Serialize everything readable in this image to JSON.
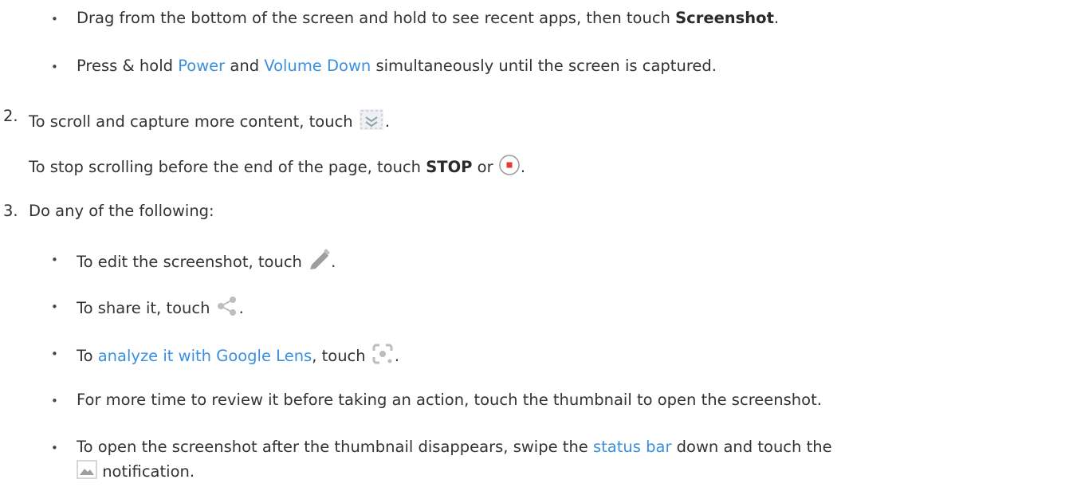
{
  "step1_bullets": {
    "recent": {
      "before": "Drag from the bottom of the screen and hold to see recent apps, then touch ",
      "bold": "Screenshot",
      "after": "."
    },
    "buttons": {
      "before": "Press & hold ",
      "link1": "Power",
      "mid": " and ",
      "link2": "Volume Down",
      "after": " simultaneously until the screen is captured."
    }
  },
  "step2": {
    "number": "2.",
    "text": "To scroll and capture more content, touch ",
    "icon": "scroll-capture-icon",
    "after": ".",
    "stop": {
      "before": "To stop scrolling before the end of the page, touch ",
      "bold": "STOP",
      "mid": " or ",
      "icon": "stop-record-icon",
      "after": "."
    }
  },
  "step3": {
    "number": "3.",
    "text": "Do any of the following:",
    "items": {
      "edit": {
        "text": "To edit the screenshot, touch ",
        "icon": "pencil-icon",
        "after": "."
      },
      "share": {
        "text": "To share it, touch ",
        "icon": "share-icon",
        "after": "."
      },
      "lens": {
        "before": "To ",
        "link": "analyze it with Google Lens",
        "mid": ", touch ",
        "icon": "google-lens-icon",
        "after": "."
      },
      "thumb": {
        "text": "For more time to review it before taking an action, touch the thumbnail to open the screenshot."
      },
      "open": {
        "before": "To open the screenshot after the thumbnail disappears, swipe the ",
        "link": "status bar",
        "mid": " down and touch the",
        "icon": "image-notification-icon",
        "line2": " notification."
      }
    }
  },
  "colors": {
    "link": "#3a8fde",
    "text": "#333333",
    "icon_gray": "#9e9e9e",
    "stop_red": "#e53935"
  }
}
